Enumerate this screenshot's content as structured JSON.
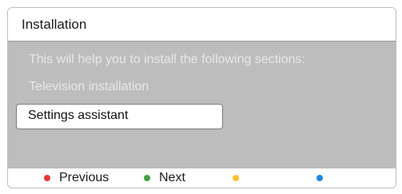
{
  "window": {
    "title": "Installation"
  },
  "panel": {
    "intro": "This will help you to install the following sections:",
    "items": [
      {
        "label": "Television installation",
        "selected": false
      },
      {
        "label": "Settings assistant",
        "selected": true
      }
    ]
  },
  "footer": {
    "buttons": [
      {
        "label": "Previous",
        "color": "#e53935",
        "icon": "red-dot-icon"
      },
      {
        "label": "Next",
        "color": "#43a047",
        "icon": "green-dot-icon"
      },
      {
        "label": "",
        "color": "#fbc02d",
        "icon": "yellow-dot-icon"
      },
      {
        "label": "",
        "color": "#1e88e5",
        "icon": "blue-dot-icon"
      }
    ]
  }
}
